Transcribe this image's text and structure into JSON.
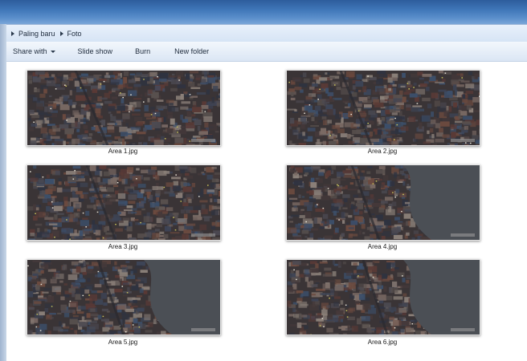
{
  "breadcrumb": {
    "items": [
      "Paling baru",
      "Foto"
    ]
  },
  "toolbar": {
    "share_label": "Share with",
    "slideshow_label": "Slide show",
    "burn_label": "Burn",
    "newfolder_label": "New folder"
  },
  "files": [
    {
      "name": "Area 1.jpg",
      "icon": "image-thumbnail",
      "has_water": false
    },
    {
      "name": "Area 2.jpg",
      "icon": "image-thumbnail",
      "has_water": false
    },
    {
      "name": "Area 3.jpg",
      "icon": "image-thumbnail",
      "has_water": false
    },
    {
      "name": "Area 4.jpg",
      "icon": "image-thumbnail",
      "has_water": true
    },
    {
      "name": "Area 5.jpg",
      "icon": "image-thumbnail",
      "has_water": true
    },
    {
      "name": "Area 6.jpg",
      "icon": "image-thumbnail",
      "has_water": true
    }
  ],
  "colors": {
    "titlebar": "#3f76b8",
    "urban_base": "#3a3436",
    "water": "#4b4f55"
  }
}
